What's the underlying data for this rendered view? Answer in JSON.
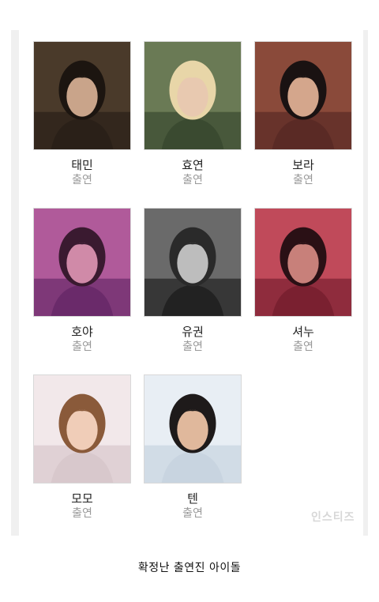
{
  "cards": [
    {
      "name": "태민",
      "role": "출연",
      "bg": "#4a3a2a",
      "accent": "#2a2018",
      "skin": "#c9a48a",
      "hair": "#1c1510"
    },
    {
      "name": "효연",
      "role": "출연",
      "bg": "#6a7a55",
      "accent": "#3a4a30",
      "skin": "#e8c9b0",
      "hair": "#e8d6a8"
    },
    {
      "name": "보라",
      "role": "출연",
      "bg": "#8a4a3a",
      "accent": "#5a2a25",
      "skin": "#d4a68c",
      "hair": "#1a1212"
    },
    {
      "name": "호야",
      "role": "출연",
      "bg": "#b05a9a",
      "accent": "#6a2a6a",
      "skin": "#d08aa8",
      "hair": "#3a1a30"
    },
    {
      "name": "유권",
      "role": "출연",
      "bg": "#6a6a6a",
      "accent": "#222222",
      "skin": "#bdbdbd",
      "hair": "#2a2a2a"
    },
    {
      "name": "셔누",
      "role": "출연",
      "bg": "#c04a5a",
      "accent": "#7a2030",
      "skin": "#c8807a",
      "hair": "#2a1015"
    },
    {
      "name": "모모",
      "role": "출연",
      "bg": "#f2e8ea",
      "accent": "#d8c8cc",
      "skin": "#f0cdb8",
      "hair": "#8a5a3a"
    },
    {
      "name": "텐",
      "role": "출연",
      "bg": "#e8eef4",
      "accent": "#c8d4e0",
      "skin": "#e0b89c",
      "hair": "#1e1a1a"
    }
  ],
  "caption": "확정난 출연진 아이돌",
  "watermark": "인스티즈"
}
